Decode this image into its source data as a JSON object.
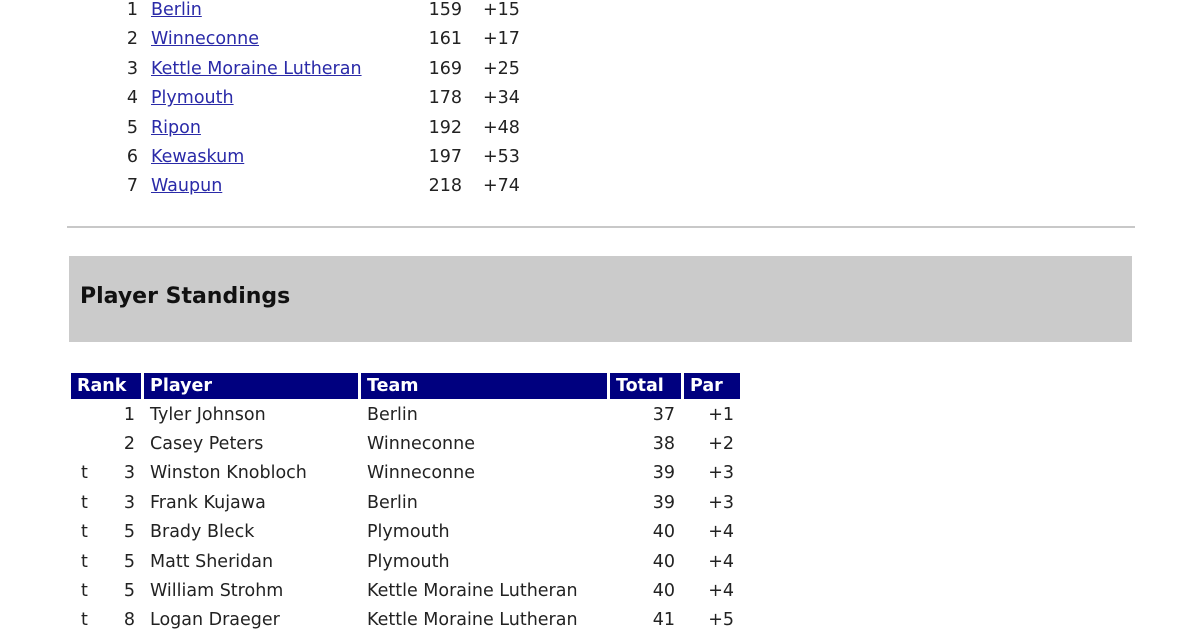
{
  "team_standings": [
    {
      "rank": "1",
      "team": "Berlin",
      "total": "159",
      "par": "+15"
    },
    {
      "rank": "2",
      "team": "Winneconne",
      "total": "161",
      "par": "+17"
    },
    {
      "rank": "3",
      "team": "Kettle Moraine Lutheran",
      "total": "169",
      "par": "+25"
    },
    {
      "rank": "4",
      "team": "Plymouth",
      "total": "178",
      "par": "+34"
    },
    {
      "rank": "5",
      "team": "Ripon",
      "total": "192",
      "par": "+48"
    },
    {
      "rank": "6",
      "team": "Kewaskum",
      "total": "197",
      "par": "+53"
    },
    {
      "rank": "7",
      "team": "Waupun",
      "total": "218",
      "par": "+74"
    }
  ],
  "player_section": {
    "title": "Player Standings",
    "headers": [
      "Rank",
      "Player",
      "Team",
      "Total",
      "Par"
    ],
    "header_color": "#00007f",
    "rows": [
      {
        "tie": "",
        "rank": "1",
        "player": "Tyler Johnson",
        "team": "Berlin",
        "total": "37",
        "par": "+1"
      },
      {
        "tie": "",
        "rank": "2",
        "player": "Casey Peters",
        "team": "Winneconne",
        "total": "38",
        "par": "+2"
      },
      {
        "tie": "t",
        "rank": "3",
        "player": "Winston Knobloch",
        "team": "Winneconne",
        "total": "39",
        "par": "+3"
      },
      {
        "tie": "t",
        "rank": "3",
        "player": "Frank Kujawa",
        "team": "Berlin",
        "total": "39",
        "par": "+3"
      },
      {
        "tie": "t",
        "rank": "5",
        "player": "Brady Bleck",
        "team": "Plymouth",
        "total": "40",
        "par": "+4"
      },
      {
        "tie": "t",
        "rank": "5",
        "player": "Matt Sheridan",
        "team": "Plymouth",
        "total": "40",
        "par": "+4"
      },
      {
        "tie": "t",
        "rank": "5",
        "player": "William Strohm",
        "team": "Kettle Moraine Lutheran",
        "total": "40",
        "par": "+4"
      },
      {
        "tie": "t",
        "rank": "8",
        "player": "Logan Draeger",
        "team": "Kettle Moraine Lutheran",
        "total": "41",
        "par": "+5"
      }
    ]
  }
}
